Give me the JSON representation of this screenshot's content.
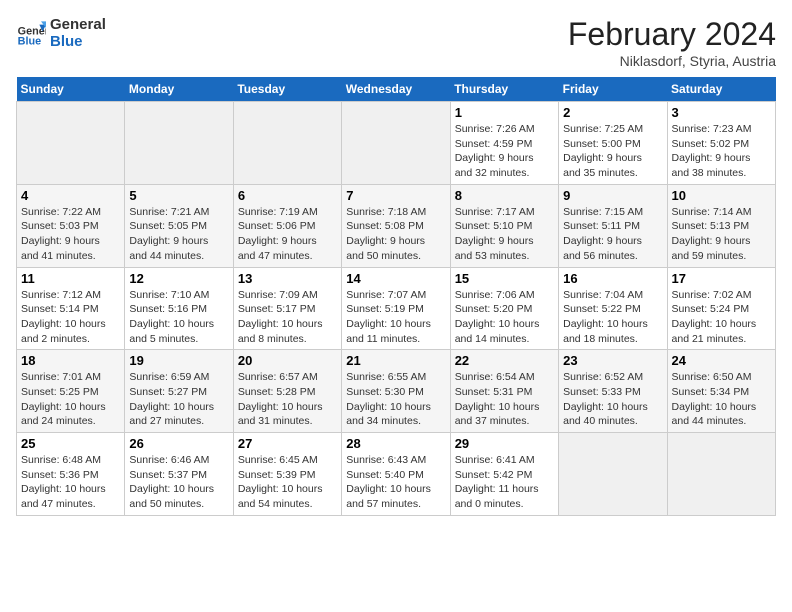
{
  "logo": {
    "line1": "General",
    "line2": "Blue"
  },
  "title": "February 2024",
  "subtitle": "Niklasdorf, Styria, Austria",
  "weekdays": [
    "Sunday",
    "Monday",
    "Tuesday",
    "Wednesday",
    "Thursday",
    "Friday",
    "Saturday"
  ],
  "weeks": [
    [
      {
        "day": "",
        "info": ""
      },
      {
        "day": "",
        "info": ""
      },
      {
        "day": "",
        "info": ""
      },
      {
        "day": "",
        "info": ""
      },
      {
        "day": "1",
        "info": "Sunrise: 7:26 AM\nSunset: 4:59 PM\nDaylight: 9 hours\nand 32 minutes."
      },
      {
        "day": "2",
        "info": "Sunrise: 7:25 AM\nSunset: 5:00 PM\nDaylight: 9 hours\nand 35 minutes."
      },
      {
        "day": "3",
        "info": "Sunrise: 7:23 AM\nSunset: 5:02 PM\nDaylight: 9 hours\nand 38 minutes."
      }
    ],
    [
      {
        "day": "4",
        "info": "Sunrise: 7:22 AM\nSunset: 5:03 PM\nDaylight: 9 hours\nand 41 minutes."
      },
      {
        "day": "5",
        "info": "Sunrise: 7:21 AM\nSunset: 5:05 PM\nDaylight: 9 hours\nand 44 minutes."
      },
      {
        "day": "6",
        "info": "Sunrise: 7:19 AM\nSunset: 5:06 PM\nDaylight: 9 hours\nand 47 minutes."
      },
      {
        "day": "7",
        "info": "Sunrise: 7:18 AM\nSunset: 5:08 PM\nDaylight: 9 hours\nand 50 minutes."
      },
      {
        "day": "8",
        "info": "Sunrise: 7:17 AM\nSunset: 5:10 PM\nDaylight: 9 hours\nand 53 minutes."
      },
      {
        "day": "9",
        "info": "Sunrise: 7:15 AM\nSunset: 5:11 PM\nDaylight: 9 hours\nand 56 minutes."
      },
      {
        "day": "10",
        "info": "Sunrise: 7:14 AM\nSunset: 5:13 PM\nDaylight: 9 hours\nand 59 minutes."
      }
    ],
    [
      {
        "day": "11",
        "info": "Sunrise: 7:12 AM\nSunset: 5:14 PM\nDaylight: 10 hours\nand 2 minutes."
      },
      {
        "day": "12",
        "info": "Sunrise: 7:10 AM\nSunset: 5:16 PM\nDaylight: 10 hours\nand 5 minutes."
      },
      {
        "day": "13",
        "info": "Sunrise: 7:09 AM\nSunset: 5:17 PM\nDaylight: 10 hours\nand 8 minutes."
      },
      {
        "day": "14",
        "info": "Sunrise: 7:07 AM\nSunset: 5:19 PM\nDaylight: 10 hours\nand 11 minutes."
      },
      {
        "day": "15",
        "info": "Sunrise: 7:06 AM\nSunset: 5:20 PM\nDaylight: 10 hours\nand 14 minutes."
      },
      {
        "day": "16",
        "info": "Sunrise: 7:04 AM\nSunset: 5:22 PM\nDaylight: 10 hours\nand 18 minutes."
      },
      {
        "day": "17",
        "info": "Sunrise: 7:02 AM\nSunset: 5:24 PM\nDaylight: 10 hours\nand 21 minutes."
      }
    ],
    [
      {
        "day": "18",
        "info": "Sunrise: 7:01 AM\nSunset: 5:25 PM\nDaylight: 10 hours\nand 24 minutes."
      },
      {
        "day": "19",
        "info": "Sunrise: 6:59 AM\nSunset: 5:27 PM\nDaylight: 10 hours\nand 27 minutes."
      },
      {
        "day": "20",
        "info": "Sunrise: 6:57 AM\nSunset: 5:28 PM\nDaylight: 10 hours\nand 31 minutes."
      },
      {
        "day": "21",
        "info": "Sunrise: 6:55 AM\nSunset: 5:30 PM\nDaylight: 10 hours\nand 34 minutes."
      },
      {
        "day": "22",
        "info": "Sunrise: 6:54 AM\nSunset: 5:31 PM\nDaylight: 10 hours\nand 37 minutes."
      },
      {
        "day": "23",
        "info": "Sunrise: 6:52 AM\nSunset: 5:33 PM\nDaylight: 10 hours\nand 40 minutes."
      },
      {
        "day": "24",
        "info": "Sunrise: 6:50 AM\nSunset: 5:34 PM\nDaylight: 10 hours\nand 44 minutes."
      }
    ],
    [
      {
        "day": "25",
        "info": "Sunrise: 6:48 AM\nSunset: 5:36 PM\nDaylight: 10 hours\nand 47 minutes."
      },
      {
        "day": "26",
        "info": "Sunrise: 6:46 AM\nSunset: 5:37 PM\nDaylight: 10 hours\nand 50 minutes."
      },
      {
        "day": "27",
        "info": "Sunrise: 6:45 AM\nSunset: 5:39 PM\nDaylight: 10 hours\nand 54 minutes."
      },
      {
        "day": "28",
        "info": "Sunrise: 6:43 AM\nSunset: 5:40 PM\nDaylight: 10 hours\nand 57 minutes."
      },
      {
        "day": "29",
        "info": "Sunrise: 6:41 AM\nSunset: 5:42 PM\nDaylight: 11 hours\nand 0 minutes."
      },
      {
        "day": "",
        "info": ""
      },
      {
        "day": "",
        "info": ""
      }
    ]
  ]
}
